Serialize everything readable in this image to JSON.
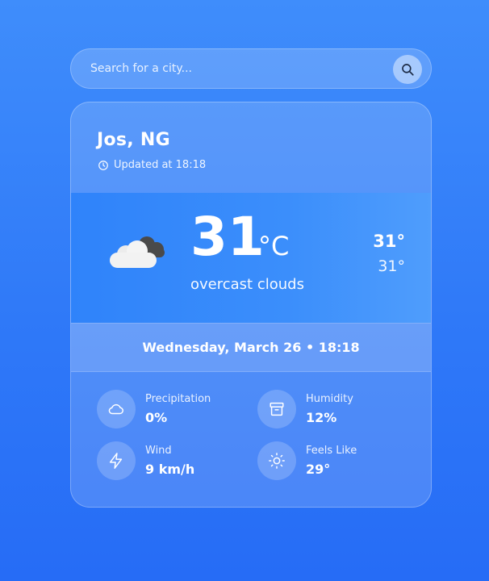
{
  "search": {
    "placeholder": "Search for a city..."
  },
  "location": "Jos, NG",
  "updated": "Updated at 18:18",
  "current": {
    "temp": "31",
    "unit": "°C",
    "description": "overcast clouds",
    "high": "31°",
    "low": "31°",
    "icon": "overcast-clouds-icon"
  },
  "datetime": "Wednesday, March 26 • 18:18",
  "stats": {
    "precipitation": {
      "label": "Precipitation",
      "value": "0%",
      "icon": "cloud-icon"
    },
    "humidity": {
      "label": "Humidity",
      "value": "12%",
      "icon": "archive-box-icon"
    },
    "wind": {
      "label": "Wind",
      "value": "9 km/h",
      "icon": "lightning-icon"
    },
    "feels_like": {
      "label": "Feels Like",
      "value": "29°",
      "icon": "sun-icon"
    }
  },
  "colors": {
    "background": "#2f79f8",
    "accent": "#3b8efb"
  }
}
